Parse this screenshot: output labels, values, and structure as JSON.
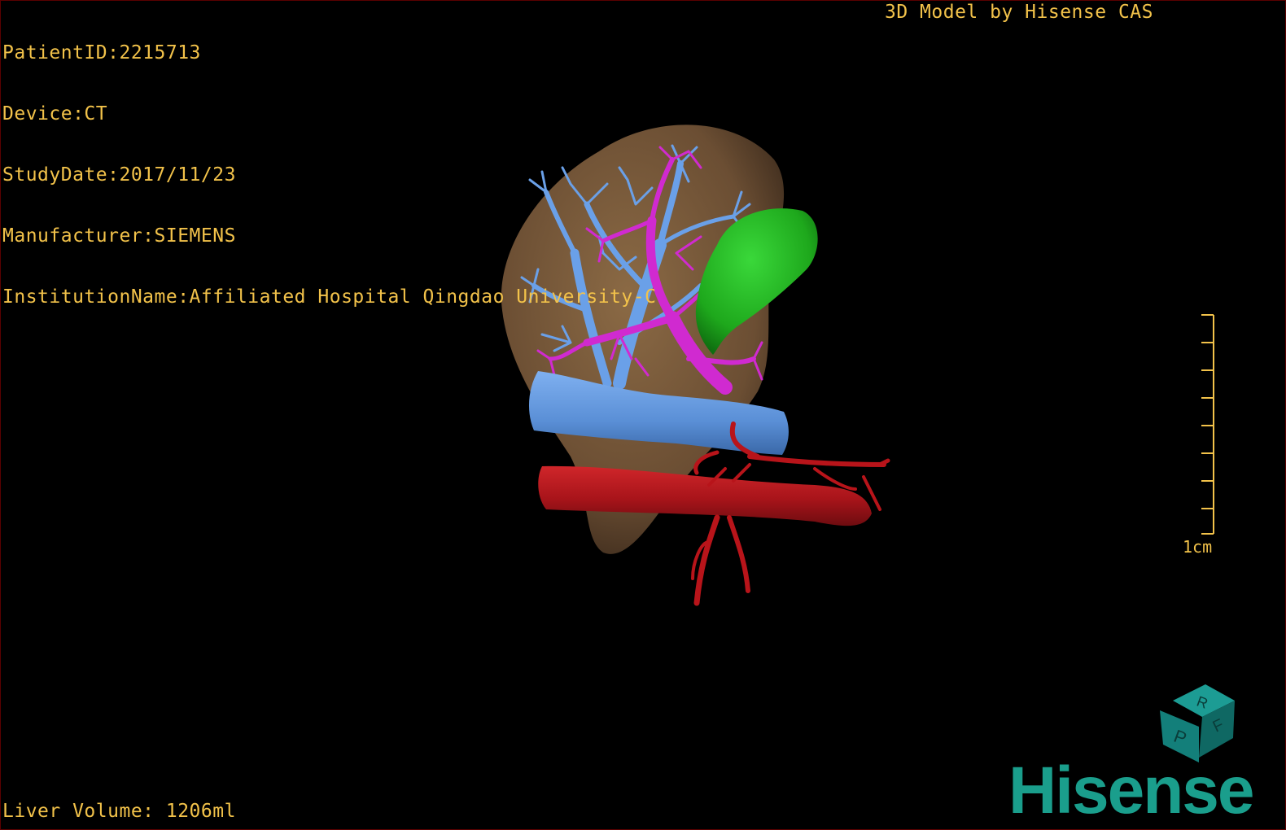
{
  "overlay": {
    "patient_id": "PatientID:2215713",
    "device": "Device:CT",
    "study_date": "StudyDate:2017/11/23",
    "manufacturer": "Manufacturer:SIEMENS",
    "institution": "InstitutionName:Affiliated Hospital Qingdao University-C",
    "model_credit": "3D Model by Hisense CAS",
    "liver_volume": "Liver Volume: 1206ml"
  },
  "scale_bar": {
    "label": "1cm"
  },
  "orientation_cube": {
    "faces": [
      "R",
      "F",
      "P"
    ]
  },
  "logo": {
    "text": "Hisense"
  },
  "colors": {
    "text": "#f2c24a",
    "liver": "#7a5a3a",
    "portal_vein": "#6aa0e8",
    "hepatic_artery": "#d02ad0",
    "gallbladder": "#22b81f",
    "aorta": "#b8141a",
    "logo": "#1a9e8c",
    "cube": "#137f7a"
  }
}
